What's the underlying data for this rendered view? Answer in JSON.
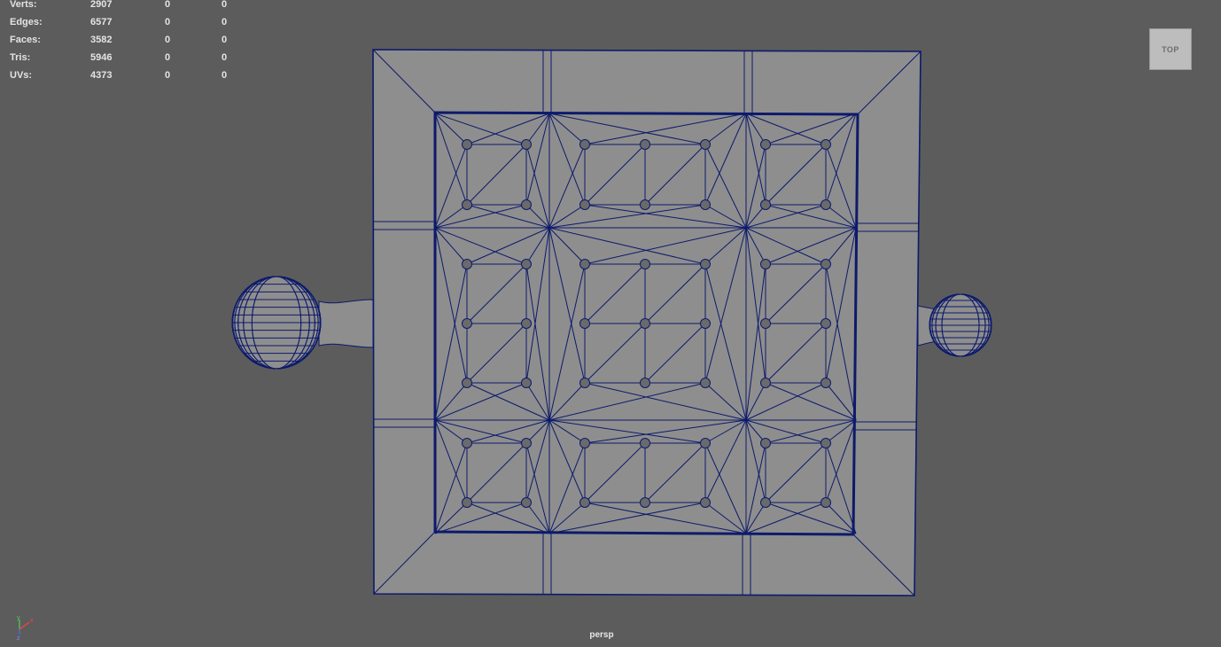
{
  "hud": {
    "rows": [
      {
        "label": "Verts:",
        "v1": "2907",
        "v2": "0",
        "v3": "0"
      },
      {
        "label": "Edges:",
        "v1": "6577",
        "v2": "0",
        "v3": "0"
      },
      {
        "label": "Faces:",
        "v1": "3582",
        "v2": "0",
        "v3": "0"
      },
      {
        "label": "Tris:",
        "v1": "5946",
        "v2": "0",
        "v3": "0"
      },
      {
        "label": "UVs:",
        "v1": "4373",
        "v2": "0",
        "v3": "0"
      }
    ]
  },
  "view_cube": {
    "label": "TOP"
  },
  "camera": {
    "label": "persp"
  },
  "axis": {
    "y": "y",
    "x": "x",
    "z": "z"
  },
  "colors": {
    "background": "#5c5c5c",
    "mesh_face": "#8e8e8e",
    "wireframe": "#0d1a6b",
    "axis_x": "#ff4040",
    "axis_y": "#4cd14c",
    "axis_z": "#4a6cff"
  }
}
